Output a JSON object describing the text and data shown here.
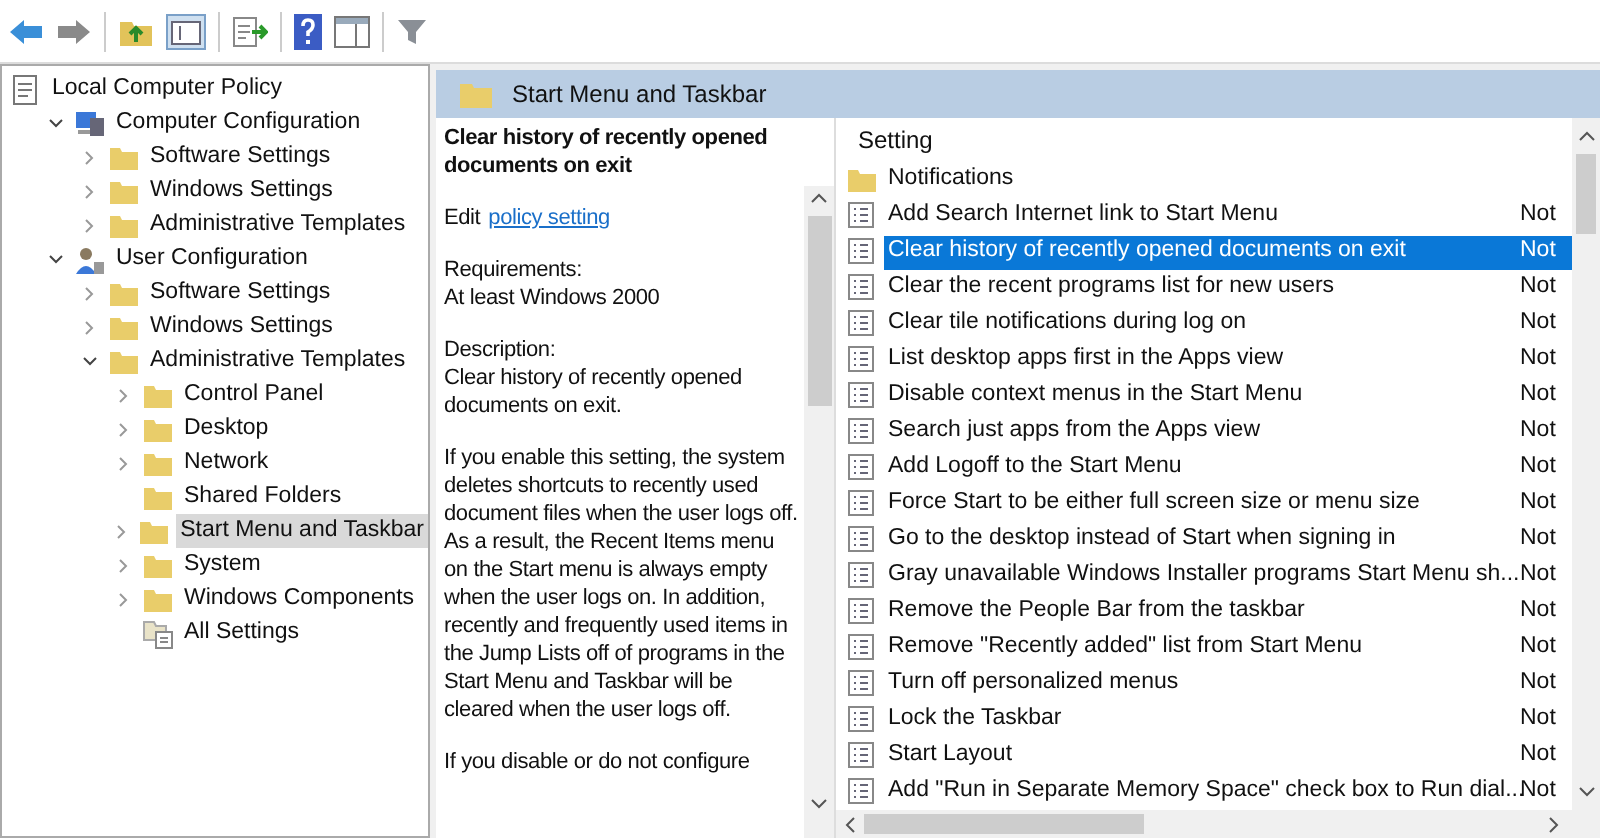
{
  "tree": [
    {
      "label": "Local Computer Policy",
      "kind": "policy",
      "selected": false,
      "children": [
        {
          "label": "Computer Configuration",
          "kind": "computer",
          "expanded": true,
          "selected": false,
          "children": [
            {
              "label": "Software Settings",
              "kind": "folder",
              "expanded": false,
              "selected": false
            },
            {
              "label": "Windows Settings",
              "kind": "folder",
              "expanded": false,
              "selected": false
            },
            {
              "label": "Administrative Templates",
              "kind": "folder",
              "expanded": false,
              "selected": false
            }
          ]
        },
        {
          "label": "User Configuration",
          "kind": "user",
          "expanded": true,
          "selected": false,
          "children": [
            {
              "label": "Software Settings",
              "kind": "folder",
              "expanded": false,
              "selected": false
            },
            {
              "label": "Windows Settings",
              "kind": "folder",
              "expanded": false,
              "selected": false
            },
            {
              "label": "Administrative Templates",
              "kind": "folder",
              "expanded": true,
              "selected": false,
              "children": [
                {
                  "label": "Control Panel",
                  "kind": "folder",
                  "expanded": false,
                  "selected": false
                },
                {
                  "label": "Desktop",
                  "kind": "folder",
                  "expanded": false,
                  "selected": false
                },
                {
                  "label": "Network",
                  "kind": "folder",
                  "expanded": false,
                  "selected": false
                },
                {
                  "label": "Shared Folders",
                  "kind": "folder",
                  "selected": false
                },
                {
                  "label": "Start Menu and Taskbar",
                  "kind": "folder",
                  "expanded": false,
                  "selected": true
                },
                {
                  "label": "System",
                  "kind": "folder",
                  "expanded": false,
                  "selected": false
                },
                {
                  "label": "Windows Components",
                  "kind": "folder",
                  "expanded": false,
                  "selected": false
                },
                {
                  "label": "All Settings",
                  "kind": "all-settings",
                  "selected": false
                }
              ]
            }
          ]
        }
      ]
    }
  ],
  "header": {
    "title": "Start Menu and Taskbar"
  },
  "description": {
    "title": "Clear history of recently opened documents on exit",
    "edit_prefix": "Edit",
    "edit_link": "policy setting",
    "paragraphs": [
      "Requirements:\nAt least Windows 2000",
      "Description:\nClear history of recently opened documents on exit.",
      "If you enable this setting, the system deletes shortcuts to recently used document files when the user logs off. As a result, the Recent Items menu on the Start menu is always empty when the user logs on. In addition, recently and frequently used items in the Jump Lists off of programs in the Start Menu and Taskbar will be cleared when the user logs off.",
      "If you disable or do not configure"
    ]
  },
  "table": {
    "columns": [
      "Setting"
    ],
    "rows": [
      {
        "kind": "folder",
        "name": "Notifications",
        "selected": false
      },
      {
        "kind": "setting",
        "name": "Add Search Internet link to Start Menu",
        "column_2": "Not",
        "selected": false
      },
      {
        "kind": "setting",
        "name": "Clear history of recently opened documents on exit",
        "column_2": "Not",
        "selected": true
      },
      {
        "kind": "setting",
        "name": "Clear the recent programs list for new users",
        "column_2": "Not",
        "selected": false
      },
      {
        "kind": "setting",
        "name": "Clear tile notifications during log on",
        "column_2": "Not",
        "selected": false
      },
      {
        "kind": "setting",
        "name": "List desktop apps first in the Apps view",
        "column_2": "Not",
        "selected": false
      },
      {
        "kind": "setting",
        "name": "Disable context menus in the Start Menu",
        "column_2": "Not",
        "selected": false
      },
      {
        "kind": "setting",
        "name": "Search just apps from the Apps view",
        "column_2": "Not",
        "selected": false
      },
      {
        "kind": "setting",
        "name": "Add Logoff to the Start Menu",
        "column_2": "Not",
        "selected": false
      },
      {
        "kind": "setting",
        "name": "Force Start to be either full screen size or menu size",
        "column_2": "Not",
        "selected": false
      },
      {
        "kind": "setting",
        "name": "Go to the desktop instead of Start when signing in",
        "column_2": "Not",
        "selected": false
      },
      {
        "kind": "setting",
        "name": "Gray unavailable Windows Installer programs Start Menu sh...",
        "column_2": "Not",
        "selected": false
      },
      {
        "kind": "setting",
        "name": "Remove the People Bar from the taskbar",
        "column_2": "Not",
        "selected": false
      },
      {
        "kind": "setting",
        "name": "Remove \"Recently added\" list from Start Menu",
        "column_2": "Not",
        "selected": false
      },
      {
        "kind": "setting",
        "name": "Turn off personalized menus",
        "column_2": "Not",
        "selected": false
      },
      {
        "kind": "setting",
        "name": "Lock the Taskbar",
        "column_2": "Not",
        "selected": false
      },
      {
        "kind": "setting",
        "name": "Start Layout",
        "column_2": "Not",
        "selected": false
      },
      {
        "kind": "setting",
        "name": "Add \"Run in Separate Memory Space\" check box to Run dial...",
        "column_2": "Not",
        "selected": false
      }
    ]
  }
}
